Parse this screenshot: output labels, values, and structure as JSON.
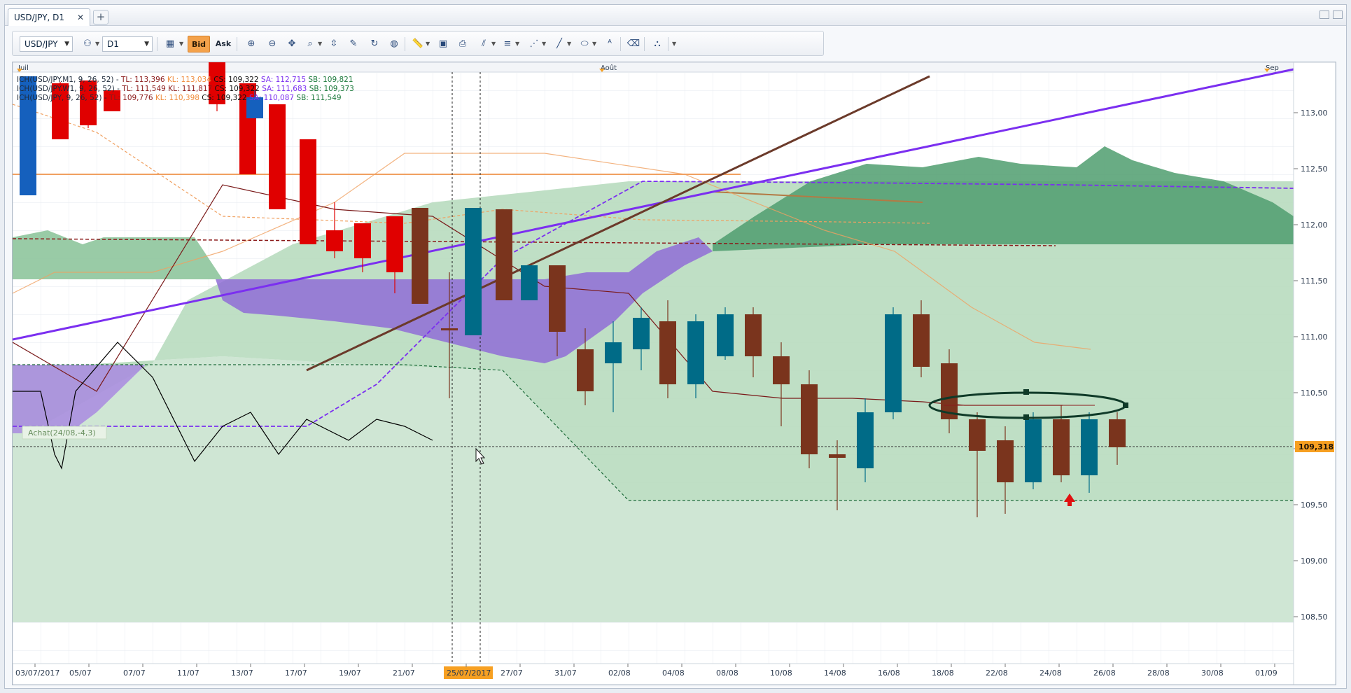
{
  "window": {
    "tab_title": "USD/JPY, D1",
    "new_tab_label": "+"
  },
  "toolbar": {
    "symbol": "USD/JPY",
    "timeframe": "D1",
    "bid_label": "Bid",
    "ask_label": "Ask",
    "icons": [
      "chart-type-icon",
      "indicator-icon",
      "zoom-in-icon",
      "zoom-out-icon",
      "crosshair-icon",
      "magnifier-icon",
      "price-scale-icon",
      "template-icon",
      "refresh-icon",
      "globe-icon",
      "ruler-icon",
      "screenshot-icon",
      "print-icon",
      "fibonacci-icon",
      "lines-icon",
      "trend-tool-icon",
      "pen-icon",
      "ellipse-icon",
      "text-icon",
      "eraser-icon",
      "objects-icon"
    ]
  },
  "chart": {
    "months": [
      "Juil",
      "Août",
      "Sep"
    ],
    "price_labels": [
      "113,00",
      "112,50",
      "112,00",
      "111,50",
      "111,00",
      "110,50",
      "110,00",
      "109,50",
      "109,00",
      "108,50"
    ],
    "current_price": "109,318",
    "date_labels": [
      "03/07/2017",
      "05/07",
      "07/07",
      "11/07",
      "13/07",
      "17/07",
      "19/07",
      "21/07",
      "25/07/2017",
      "27/07",
      "31/07",
      "02/08",
      "04/08",
      "08/08",
      "10/08",
      "14/08",
      "16/08",
      "18/08",
      "22/08",
      "24/08",
      "26/08",
      "28/08",
      "30/08",
      "01/09"
    ],
    "highlighted_date": "25/07/2017",
    "indicator_lines": [
      {
        "name": "ICH(USD/JPY.M1, 9, 26, 52) -",
        "tl": "TL: 113,396",
        "kl": "KL: 113,034",
        "cs": "CS: 109,322",
        "sa": "SA: 112,715",
        "sb": "SB: 109,821"
      },
      {
        "name": "ICH(USD/JPY.W1, 9, 26, 52) -",
        "tl": "TL: 111,549",
        "kl": "KL: 111,817",
        "cs": "CS: 109,322",
        "sa": "SA: 111,683",
        "sb": "SB: 109,373"
      },
      {
        "name": "ICH(USD/JPY, 9, 26, 52) -",
        "tl": "TL: 109,776",
        "kl": "KL: 110,398",
        "cs": "CS: 109,322",
        "sa": "SA: 110,087",
        "sb": "SB: 111,549"
      }
    ],
    "signal_label": "Achat(24/08,-4,3)",
    "colors": {
      "bull": "#006b87",
      "bear": "#7a341d",
      "bull_old": "#1560bd",
      "bear_old": "#e00000",
      "purple": "#7b2ff0",
      "cloud_green": "#2e8b57",
      "price_tag": "#f7a022"
    }
  }
}
